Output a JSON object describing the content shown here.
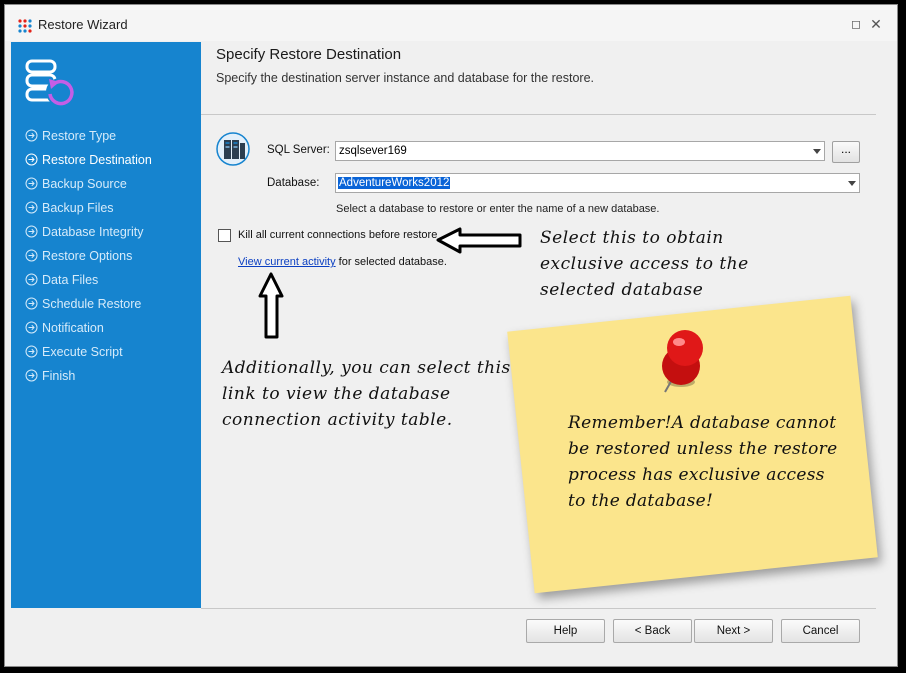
{
  "window": {
    "title": "Restore Wizard"
  },
  "sidebar": {
    "items": [
      {
        "label": "Restore Type",
        "active": false
      },
      {
        "label": "Restore Destination",
        "active": true
      },
      {
        "label": "Backup Source",
        "active": false
      },
      {
        "label": "Backup Files",
        "active": false
      },
      {
        "label": "Database Integrity",
        "active": false
      },
      {
        "label": "Restore Options",
        "active": false
      },
      {
        "label": "Data Files",
        "active": false
      },
      {
        "label": "Schedule Restore",
        "active": false
      },
      {
        "label": "Notification",
        "active": false
      },
      {
        "label": "Execute Script",
        "active": false
      },
      {
        "label": "Finish",
        "active": false
      }
    ]
  },
  "header": {
    "title": "Specify Restore Destination",
    "subtitle": "Specify the destination server instance and database for the restore."
  },
  "form": {
    "sql_server_label": "SQL Server:",
    "sql_server_value": "zsqlsever169",
    "browse_label": "...",
    "database_label": "Database:",
    "database_value": "AdventureWorks2012",
    "database_hint": "Select a database to restore or enter the name of a new database.",
    "kill_connections_label": "Kill all current connections before restore",
    "kill_connections_checked": false,
    "activity_link": "View current activity",
    "activity_suffix": " for selected database."
  },
  "annotations": {
    "checkbox_note": "Select this to obtain exclusive access to the selected database",
    "link_note": "Additionally, you can select this link to view the database connection activity table.",
    "sticky_note": "Remember!A database cannot be restored unless the restore process has exclusive access to the database!"
  },
  "footer": {
    "help": "Help",
    "back": "< Back",
    "next": "Next >",
    "cancel": "Cancel"
  },
  "colors": {
    "sidebar": "#1684cf",
    "selection": "#0a64d7",
    "sticky_note": "#fbe58c",
    "pin": "#e01818"
  }
}
